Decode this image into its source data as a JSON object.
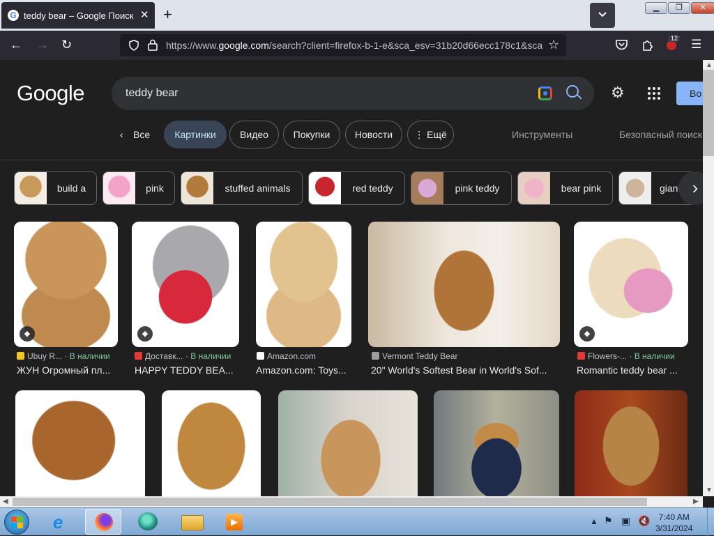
{
  "browser": {
    "tab_title": "teddy bear – Google Поиск",
    "tab_close": "✕",
    "new_tab": "+",
    "url_prefix": "https://www.",
    "url_domain": "google.com",
    "url_rest": "/search?client=firefox-b-1-e&sca_esv=31b20d66ecc178c1&sca_",
    "extension_badge": "12"
  },
  "google": {
    "logo": "Google",
    "query": "teddy bear",
    "signin_label": "Во",
    "nav": {
      "back_label": "Все",
      "tabs": [
        "Картинки",
        "Видео",
        "Покупки",
        "Новости",
        "Ещё"
      ],
      "tools": "Инструменты",
      "safe_search": "Безопасный поиск"
    },
    "related": [
      {
        "label": "build a",
        "color": "#c89a5a"
      },
      {
        "label": "pink",
        "color": "#f4a3c8"
      },
      {
        "label": "stuffed animals",
        "color": "#b27a3b"
      },
      {
        "label": "red teddy",
        "color": "#c8252d"
      },
      {
        "label": "pink teddy",
        "color": "#d9a9d6"
      },
      {
        "label": "bear pink",
        "color": "#f1b3c7"
      },
      {
        "label": "giant",
        "color": "#cdb49a"
      }
    ],
    "results_row1": [
      {
        "source": "Ubuy R...",
        "stock": "В наличии",
        "caption": "ЖУН Огромный пл...",
        "favicon": "#f5c518",
        "tagged": true
      },
      {
        "source": "Доставк...",
        "stock": "В наличии",
        "caption": "HAPPY TEDDY BEA...",
        "favicon": "#e53935",
        "tagged": true
      },
      {
        "source": "Amazon.com",
        "stock": "",
        "caption": "Amazon.com: Toys...",
        "favicon": "#ffffff",
        "tagged": false
      },
      {
        "source": "Vermont Teddy Bear",
        "stock": "",
        "caption": "20\" World's Softest Bear in World's Sof...",
        "favicon": "#9e9e9e",
        "tagged": false
      },
      {
        "source": "Flowers-...",
        "stock": "В наличии",
        "caption": "Romantic teddy bear ...",
        "favicon": "#e53935",
        "tagged": true
      }
    ]
  },
  "taskbar": {
    "time": "7:40 AM",
    "date": "3/31/2024"
  }
}
